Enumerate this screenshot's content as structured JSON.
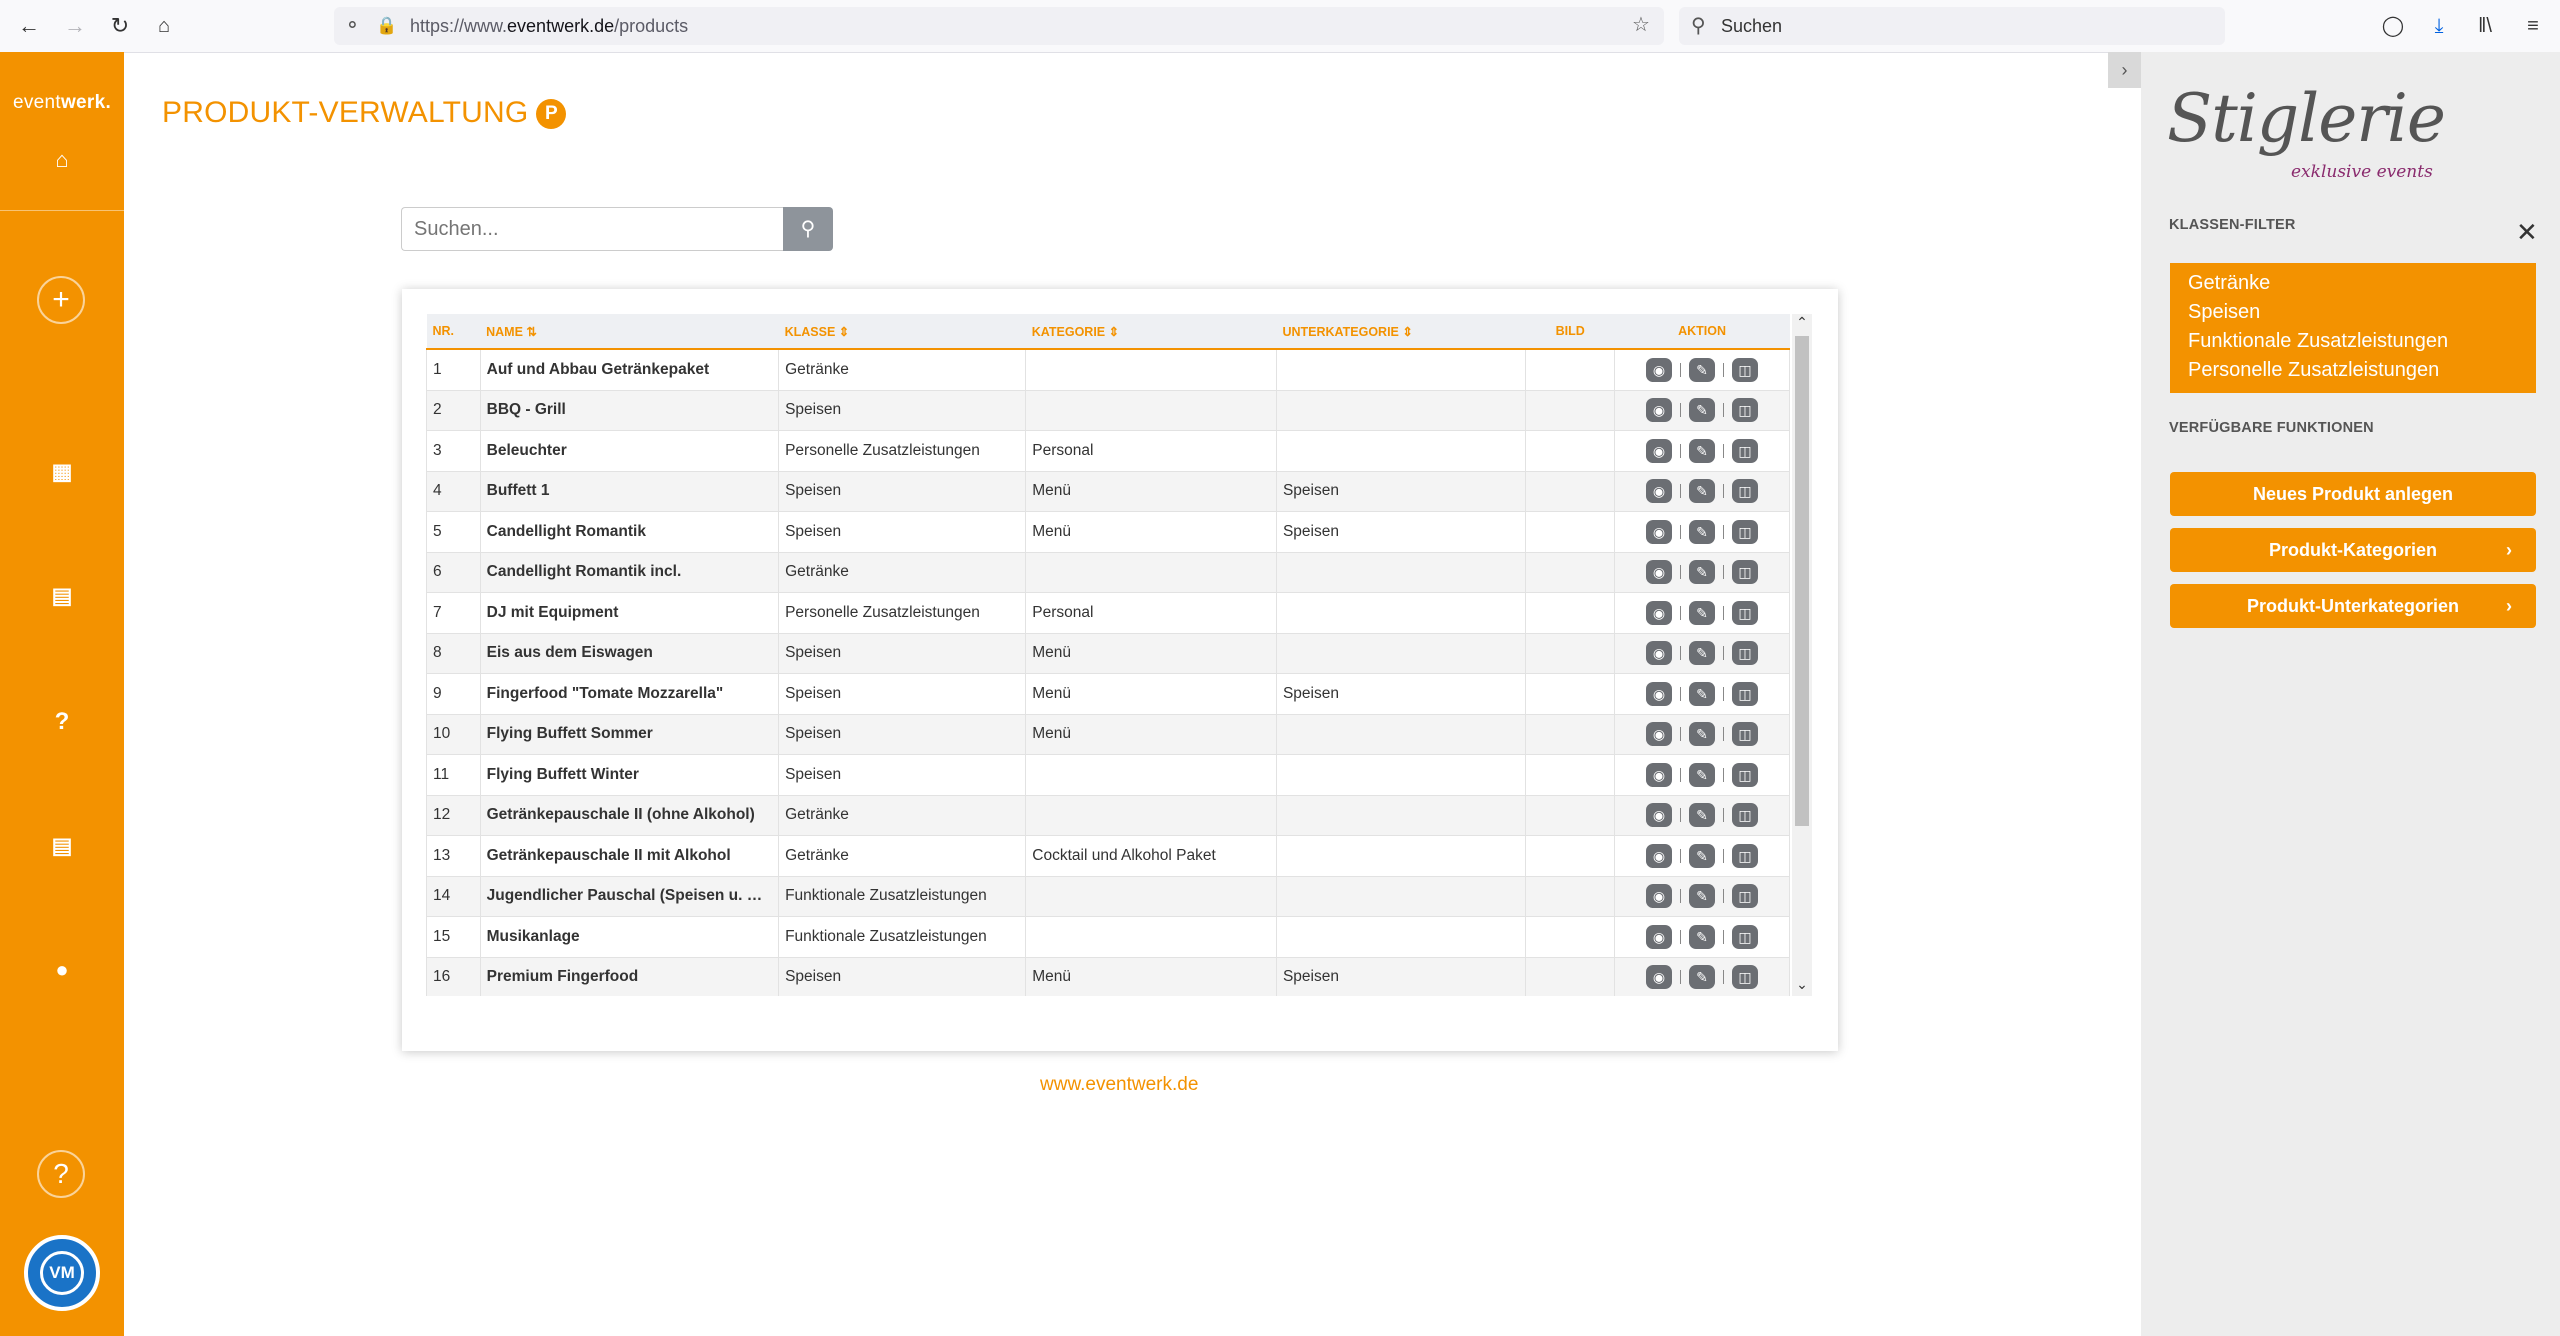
{
  "browser": {
    "url_prefix": "https://www.",
    "url_domain": "eventwerk.de",
    "url_path": "/products",
    "search_placeholder": "Suchen"
  },
  "sidebar": {
    "brand_light": "event",
    "brand_bold": "werk.",
    "help_label": "?",
    "add_label": "+"
  },
  "main": {
    "title": "PRODUKT-VERWALTUNG",
    "title_badge": "P",
    "search_placeholder": "Suchen...",
    "footer_link": "www.eventwerk.de"
  },
  "table": {
    "columns": [
      "NR.",
      "NAME",
      "KLASSE",
      "KATEGORIE",
      "UNTERKATEGORIE",
      "BILD",
      "AKTION"
    ],
    "rows": [
      {
        "nr": "1",
        "name": "Auf und Abbau Getränkepaket",
        "klasse": "Getränke",
        "kategorie": "",
        "unterkategorie": "",
        "bild": ""
      },
      {
        "nr": "2",
        "name": "BBQ - Grill",
        "klasse": "Speisen",
        "kategorie": "",
        "unterkategorie": "",
        "bild": ""
      },
      {
        "nr": "3",
        "name": "Beleuchter",
        "klasse": "Personelle Zusatzleistungen",
        "kategorie": "Personal",
        "unterkategorie": "",
        "bild": ""
      },
      {
        "nr": "4",
        "name": "Buffett 1",
        "klasse": "Speisen",
        "kategorie": "Menü",
        "unterkategorie": "Speisen",
        "bild": ""
      },
      {
        "nr": "5",
        "name": "Candellight Romantik",
        "klasse": "Speisen",
        "kategorie": "Menü",
        "unterkategorie": "Speisen",
        "bild": ""
      },
      {
        "nr": "6",
        "name": "Candellight Romantik incl.",
        "klasse": "Getränke",
        "kategorie": "",
        "unterkategorie": "",
        "bild": ""
      },
      {
        "nr": "7",
        "name": "DJ mit Equipment",
        "klasse": "Personelle Zusatzleistungen",
        "kategorie": "Personal",
        "unterkategorie": "",
        "bild": ""
      },
      {
        "nr": "8",
        "name": "Eis aus dem Eiswagen",
        "klasse": "Speisen",
        "kategorie": "Menü",
        "unterkategorie": "",
        "bild": ""
      },
      {
        "nr": "9",
        "name": "Fingerfood \"Tomate Mozzarella\"",
        "klasse": "Speisen",
        "kategorie": "Menü",
        "unterkategorie": "Speisen",
        "bild": ""
      },
      {
        "nr": "10",
        "name": "Flying Buffett Sommer",
        "klasse": "Speisen",
        "kategorie": "Menü",
        "unterkategorie": "",
        "bild": ""
      },
      {
        "nr": "11",
        "name": "Flying Buffett Winter",
        "klasse": "Speisen",
        "kategorie": "",
        "unterkategorie": "",
        "bild": ""
      },
      {
        "nr": "12",
        "name": "Getränkepauschale II (ohne Alkohol)",
        "klasse": "Getränke",
        "kategorie": "",
        "unterkategorie": "",
        "bild": ""
      },
      {
        "nr": "13",
        "name": "Getränkepauschale II mit Alkohol",
        "klasse": "Getränke",
        "kategorie": "Cocktail und Alkohol Paket",
        "unterkategorie": "",
        "bild": ""
      },
      {
        "nr": "14",
        "name": "Jugendlicher Pauschal (Speisen u. Getränke)",
        "klasse": "Funktionale Zusatzleistungen",
        "kategorie": "",
        "unterkategorie": "",
        "bild": ""
      },
      {
        "nr": "15",
        "name": "Musikanlage",
        "klasse": "Funktionale Zusatzleistungen",
        "kategorie": "",
        "unterkategorie": "",
        "bild": ""
      },
      {
        "nr": "16",
        "name": "Premium Fingerfood",
        "klasse": "Speisen",
        "kategorie": "Menü",
        "unterkategorie": "Speisen",
        "bild": ""
      }
    ]
  },
  "right_panel": {
    "logo": "Stiglerie",
    "logo_sub": "exklusive events",
    "filter_heading": "KLASSEN-FILTER",
    "filters": [
      "Getränke",
      "Speisen",
      "Funktionale Zusatzleistungen",
      "Personelle Zusatzleistungen"
    ],
    "functions_heading": "VERFÜGBARE FUNKTIONEN",
    "buttons": [
      "Neues Produkt anlegen",
      "Produkt-Kategorien",
      "Produkt-Unterkategorien"
    ]
  },
  "colors": {
    "brand_orange": "#f39200",
    "sidebar_bg": "#f39200",
    "panel_bg": "#ededed",
    "action_button": "#6b6e73"
  },
  "icons": [
    "back-icon",
    "forward-icon",
    "reload-icon",
    "home-icon",
    "shield-icon",
    "lock-icon",
    "star-icon",
    "search-icon",
    "pocket-icon",
    "download-icon",
    "library-icon",
    "menu-icon",
    "home-icon",
    "plus-icon",
    "calendar-icon",
    "list-icon",
    "question-icon",
    "table-icon",
    "user-icon",
    "help-icon",
    "eye-icon",
    "edit-icon",
    "trash-icon",
    "close-icon",
    "chevron-right-icon"
  ]
}
